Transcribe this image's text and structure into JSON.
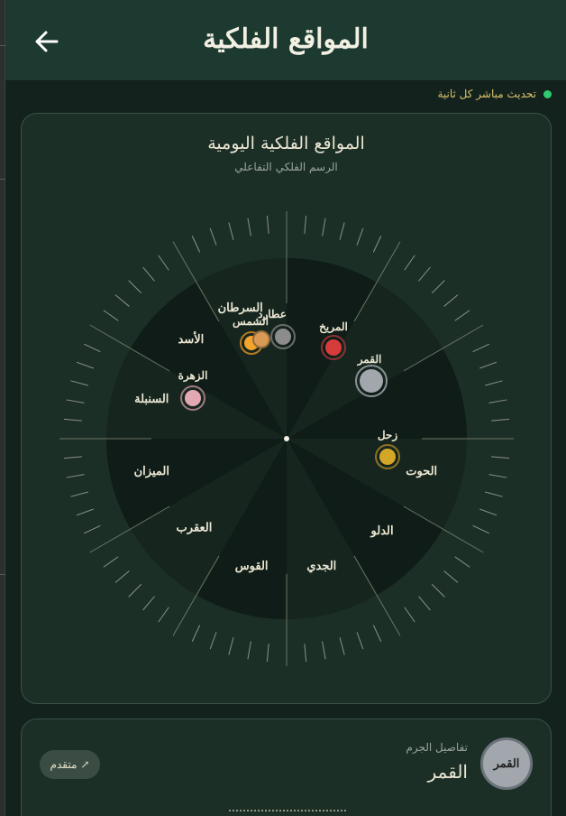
{
  "header": {
    "title": "المواقع الفلكية",
    "back_icon": "arrow-left-icon"
  },
  "status": {
    "live_text": "تحديث مباشر كل ثانية",
    "dot_color": "#2ecc71"
  },
  "chart": {
    "title": "المواقع الفلكية اليومية",
    "subtitle": "الرسم الفلكي التفاعلي",
    "sign_labels": [
      "الحوت",
      "الدلو",
      "الجدي",
      "القوس",
      "العقرب",
      "الميزان",
      "السنبلة",
      "الأسد",
      "السرطان"
    ],
    "center_label": "",
    "planets": [
      {
        "name": "القمر",
        "color": "#a2a7ad",
        "ring": "#8a9097",
        "size": "large"
      },
      {
        "name": "المريخ",
        "color": "#d63c3c",
        "ring": "#8c3333",
        "size": "small"
      },
      {
        "name": "عطارد",
        "color": "#8c8c8c",
        "ring": "#6b6b6b",
        "size": "small"
      },
      {
        "name": "الشمس",
        "color": "#f4a32b",
        "ring": "#b57a20",
        "size": "small"
      },
      {
        "name": "الزهرة",
        "color": "#e3a9b3",
        "ring": "#9c7a80",
        "size": "small"
      },
      {
        "name": "زحل",
        "color": "#d4a628",
        "ring": "#8e7224",
        "size": "small"
      }
    ]
  },
  "detail": {
    "label": "تفاصيل الجرم",
    "name": "القمر",
    "circle_label": "القمر",
    "advanced_label": "متقدم",
    "advanced_icon": "arrow-up-right-icon"
  }
}
